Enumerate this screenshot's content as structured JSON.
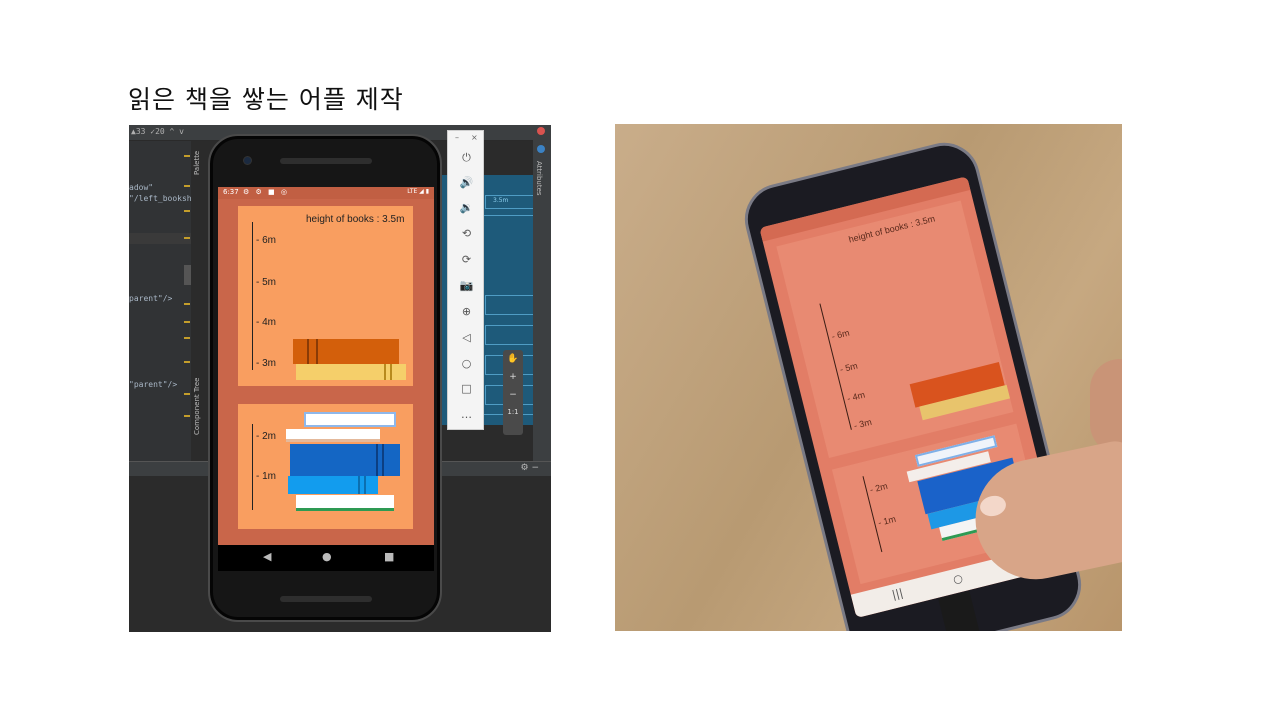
{
  "slide": {
    "title": "읽은 책을 쌓는 어플 제작"
  },
  "ide": {
    "topbar_counts": "▲33  ✓20  ^  v",
    "palette_tab": "Palette",
    "component_tree_tab": "Component Tree",
    "attributes_tab": "Attributes",
    "code_lines": [
      "adow\"",
      "\"/left_booksh",
      "parent\"/>",
      "\"parent\"/>"
    ],
    "blueprint_labels": [
      "3.5m",
      "W",
      "W",
      "3W",
      "W",
      "W"
    ]
  },
  "emulator_tools": {
    "close": "×",
    "minimize": "–",
    "icons": [
      "power-icon",
      "volume-up-icon",
      "volume-down-icon",
      "rotate-left-icon",
      "rotate-right-icon",
      "camera-icon",
      "zoom-in-icon",
      "back-icon",
      "home-icon",
      "overview-icon",
      "more-icon"
    ],
    "glyphs": [
      "⏻",
      "🔊",
      "🔉",
      "⟲",
      "⟳",
      "📷",
      "⊕",
      "◁",
      "○",
      "□",
      "…"
    ]
  },
  "zoom_panel": {
    "hand": "✋",
    "plus": "+",
    "minus": "−",
    "ratio": "1:1"
  },
  "emulator_app": {
    "status_time": "6:37",
    "status_icons": "⚙ ⚙ ■ ◎",
    "status_right": "LTE ◢ ▮",
    "height_label": "height of books : 3.5m",
    "top_marks": [
      "- 6m",
      "- 5m",
      "- 4m",
      "- 3m"
    ],
    "bottom_marks": [
      "- 2m",
      "- 1m"
    ],
    "nav": {
      "back": "◀",
      "home": "●",
      "recent": "■"
    },
    "colors": {
      "background": "#c9664a",
      "shelf": "#f99e60",
      "book_orange": "#d35f0b",
      "book_yellow": "#f5cf6a",
      "book_blue_dark": "#1466c4",
      "book_blue_light": "#129cee",
      "book_white": "#ffffff",
      "book_green_stripe": "#2e9a53"
    }
  },
  "photo_app": {
    "height_label": "height of books : 3.5m",
    "top_marks": [
      "- 6m",
      "- 5m",
      "- 4m",
      "- 3m"
    ],
    "bottom_marks": [
      "- 2m",
      "- 1m"
    ],
    "nav": {
      "recent": "|||",
      "home": "○",
      "back": "<"
    }
  }
}
